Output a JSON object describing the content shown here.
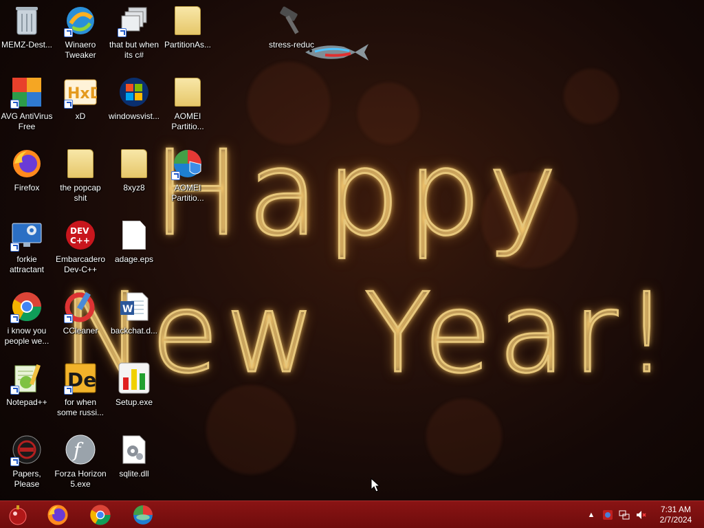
{
  "desktop": {
    "icons": [
      {
        "label": "MEMZ-Dest...",
        "icon": "recycle-bin-icon"
      },
      {
        "label": "Winaero Tweaker",
        "icon": "winaero-icon"
      },
      {
        "label": "that but when its c#",
        "icon": "windows-stack-icon"
      },
      {
        "label": "PartitionAs...",
        "icon": "folder-icon"
      },
      {
        "label": "stress-reduc",
        "icon": "hammer-icon"
      },
      {
        "label": "AVG AntiVirus Free",
        "icon": "avg-icon"
      },
      {
        "label": "xD",
        "icon": "hxd-icon"
      },
      {
        "label": "windowsvist...",
        "icon": "windows-logo-icon"
      },
      {
        "label": "AOMEI Partitio...",
        "icon": "folder-icon"
      },
      {
        "label": "Firefox",
        "icon": "firefox-icon"
      },
      {
        "label": "the popcap shit",
        "icon": "folder-icon"
      },
      {
        "label": "8xyz8",
        "icon": "folder-icon"
      },
      {
        "label": "AOMEI Partitio...",
        "icon": "aomei-icon"
      },
      {
        "label": "forkie attractant",
        "icon": "settings-monitor-icon"
      },
      {
        "label": "Embarcadero Dev-C++",
        "icon": "devcpp-icon"
      },
      {
        "label": "adage.eps",
        "icon": "document-icon"
      },
      {
        "label": "i know you people we...",
        "icon": "chrome-icon"
      },
      {
        "label": "CCleaner",
        "icon": "ccleaner-icon"
      },
      {
        "label": "backchat.d...",
        "icon": "word-document-icon"
      },
      {
        "label": "Notepad++",
        "icon": "notepadpp-icon"
      },
      {
        "label": "for when some russi...",
        "icon": "de-icon"
      },
      {
        "label": "Setup.exe",
        "icon": "setup-chart-icon"
      },
      {
        "label": "Papers, Please",
        "icon": "papers-please-icon"
      },
      {
        "label": "Forza Horizon 5.exe",
        "icon": "flash-icon"
      },
      {
        "label": "sqlite.dll",
        "icon": "gear-document-icon"
      }
    ]
  },
  "greeting": {
    "line1": "Happy",
    "line2": "New Year!"
  },
  "taskbar": {
    "pinned": [
      {
        "name": "Firefox",
        "icon": "firefox-icon"
      },
      {
        "name": "Chrome",
        "icon": "chrome-icon"
      },
      {
        "name": "AOMEI",
        "icon": "aomei-icon"
      }
    ],
    "tray": {
      "icons": [
        "chevron-up-icon",
        "security-icon",
        "network-icon",
        "volume-muted-icon"
      ]
    },
    "clock": {
      "time": "7:31 AM",
      "date": "2/7/2024"
    }
  },
  "colors": {
    "taskbar": "#7a1010",
    "glow": "#e7c77c"
  }
}
